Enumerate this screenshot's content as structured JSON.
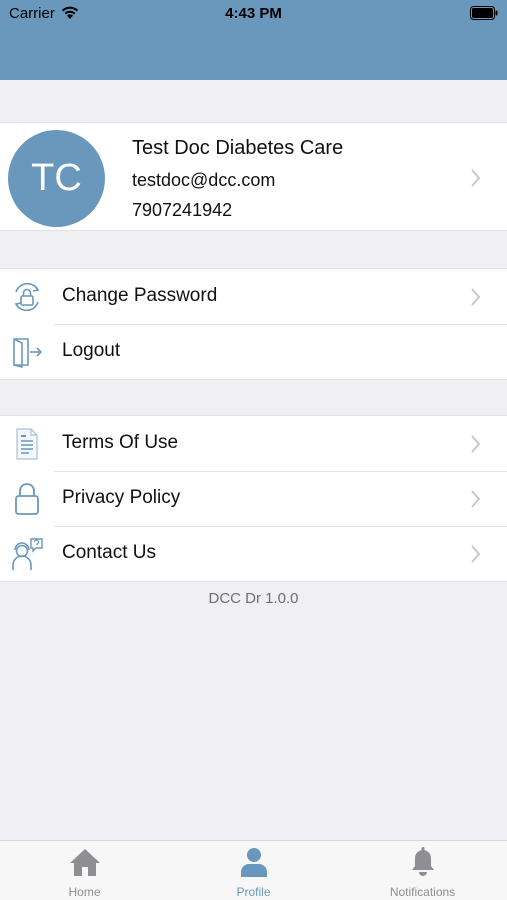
{
  "status_bar": {
    "carrier": "Carrier",
    "time": "4:43 PM"
  },
  "profile": {
    "initials": "TC",
    "name": "Test Doc Diabetes Care",
    "email": "testdoc@dcc.com",
    "phone": "7907241942"
  },
  "account_menu": [
    {
      "label": "Change Password",
      "icon": "lock-refresh-icon",
      "chevron": true
    },
    {
      "label": "Logout",
      "icon": "logout-icon",
      "chevron": false
    }
  ],
  "info_menu": [
    {
      "label": "Terms Of Use",
      "icon": "document-icon",
      "chevron": true
    },
    {
      "label": "Privacy Policy",
      "icon": "padlock-icon",
      "chevron": true
    },
    {
      "label": "Contact Us",
      "icon": "support-agent-icon",
      "chevron": true
    }
  ],
  "version": "DCC Dr 1.0.0",
  "tabs": [
    {
      "label": "Home",
      "icon": "home-icon",
      "active": false
    },
    {
      "label": "Profile",
      "icon": "person-icon",
      "active": true
    },
    {
      "label": "Notifications",
      "icon": "bell-icon",
      "active": false
    }
  ],
  "colors": {
    "header": "#6a98bc",
    "accent": "#6a98bc",
    "background": "#efeff4",
    "inactive_tab": "#8e8e93",
    "chevron": "#c7c7cc"
  }
}
